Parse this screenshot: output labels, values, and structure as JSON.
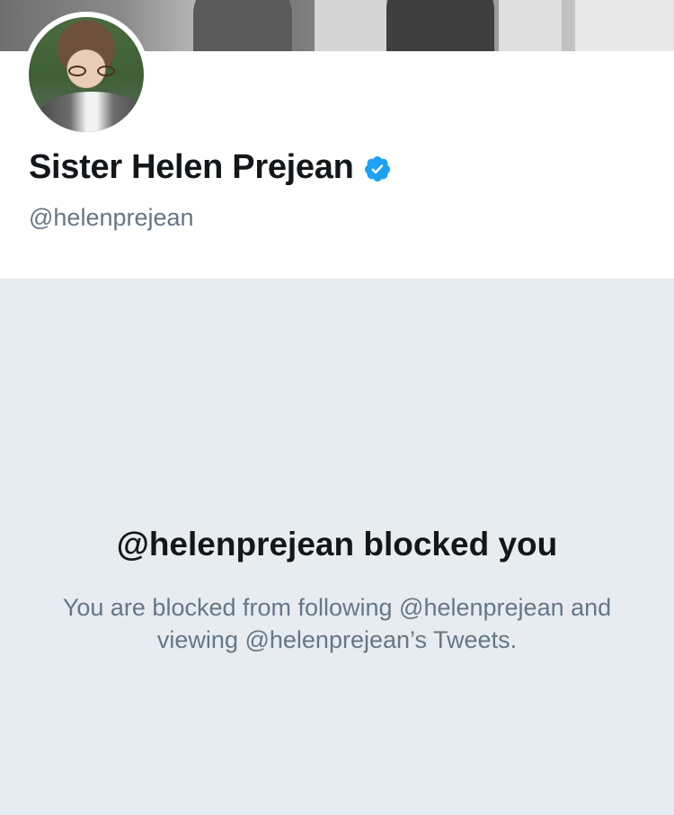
{
  "profile": {
    "display_name": "Sister Helen Prejean",
    "handle": "@helenprejean",
    "verified": true,
    "verified_icon": "verified-badge-icon"
  },
  "blocked": {
    "title": "@helenprejean blocked you",
    "description": "You are blocked from following @helenprejean and viewing @helenprejean’s Tweets."
  },
  "colors": {
    "accent": "#1da1f2",
    "text_primary": "#14171a",
    "text_secondary": "#657786",
    "background": "#e6ecf0"
  }
}
